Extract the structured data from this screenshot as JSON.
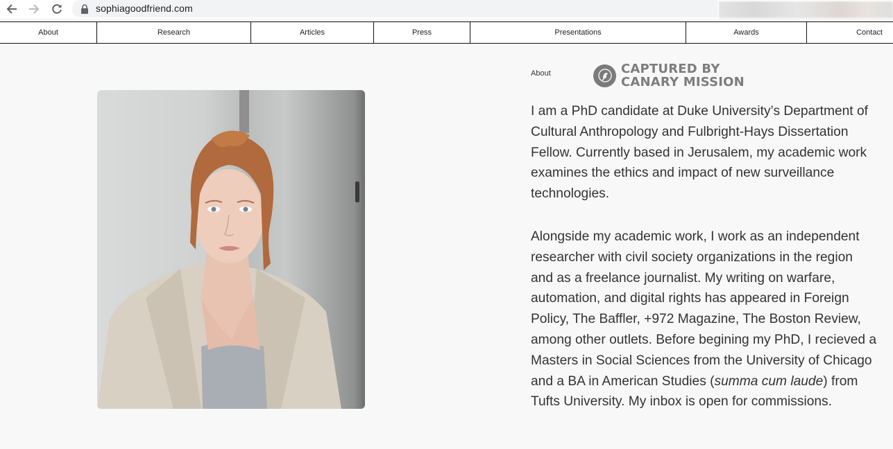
{
  "browser": {
    "url": "sophiagoodfriend.com"
  },
  "nav": {
    "items": [
      {
        "label": "About"
      },
      {
        "label": "Research"
      },
      {
        "label": "Articles"
      },
      {
        "label": "Press"
      },
      {
        "label": "Presentations"
      },
      {
        "label": "Awards"
      },
      {
        "label": "Contact"
      }
    ]
  },
  "main": {
    "section_label": "About",
    "overlay_logo": {
      "line1": "CAPTURED BY",
      "line2": "CANARY MISSION"
    },
    "bio": {
      "p1": "I am a PhD candidate at Duke University’s Department of Cultural Anthropology and Fulbright-Hays Dissertation Fellow. Currently based in Jerusalem, my academic work examines the ethics and impact of new surveillance technologies.",
      "p2_before": "Alongside my academic work, I work as an independent researcher with civil society organizations in the region and as a freelance journalist. My writing on warfare, automation, and digital rights has appeared in Foreign Policy, The Baffler, +972 Magazine, The Boston Review, among other outlets.  Before begining my PhD, I recieved a Masters in Social Sciences from the University of Chicago and a BA in American Studies (",
      "p2_italic": "summa cum laude",
      "p2_after": ") from Tufts University. My inbox is open for commissions."
    }
  }
}
